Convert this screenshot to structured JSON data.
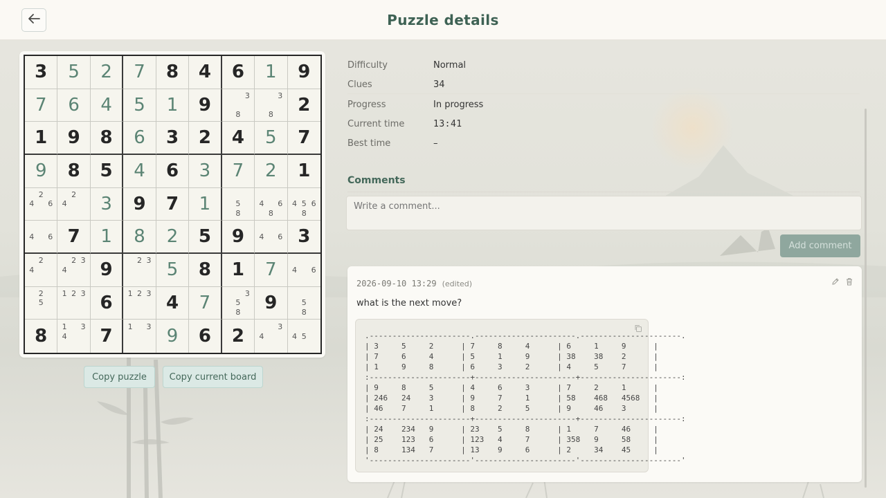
{
  "header": {
    "title": "Puzzle details",
    "back_icon": "arrow-left-icon"
  },
  "board": {
    "given_color": "#262626",
    "user_color": "#5b8474",
    "cells": [
      [
        {
          "v": "3",
          "g": true
        },
        {
          "v": "5",
          "g": false
        },
        {
          "v": "2",
          "g": false
        },
        {
          "v": "7",
          "g": false
        },
        {
          "v": "8",
          "g": true
        },
        {
          "v": "4",
          "g": true
        },
        {
          "v": "6",
          "g": true
        },
        {
          "v": "1",
          "g": false
        },
        {
          "v": "9",
          "g": true
        }
      ],
      [
        {
          "v": "7",
          "g": false
        },
        {
          "v": "6",
          "g": false
        },
        {
          "v": "4",
          "g": false
        },
        {
          "v": "5",
          "g": false
        },
        {
          "v": "1",
          "g": false
        },
        {
          "v": "9",
          "g": true
        },
        {
          "n": "38"
        },
        {
          "n": "38"
        },
        {
          "v": "2",
          "g": true
        }
      ],
      [
        {
          "v": "1",
          "g": true
        },
        {
          "v": "9",
          "g": true
        },
        {
          "v": "8",
          "g": true
        },
        {
          "v": "6",
          "g": false
        },
        {
          "v": "3",
          "g": true
        },
        {
          "v": "2",
          "g": true
        },
        {
          "v": "4",
          "g": true
        },
        {
          "v": "5",
          "g": false
        },
        {
          "v": "7",
          "g": true
        }
      ],
      [
        {
          "v": "9",
          "g": false
        },
        {
          "v": "8",
          "g": true
        },
        {
          "v": "5",
          "g": true
        },
        {
          "v": "4",
          "g": false
        },
        {
          "v": "6",
          "g": true
        },
        {
          "v": "3",
          "g": false
        },
        {
          "v": "7",
          "g": false
        },
        {
          "v": "2",
          "g": false
        },
        {
          "v": "1",
          "g": true
        }
      ],
      [
        {
          "n": "246"
        },
        {
          "n": "24"
        },
        {
          "v": "3",
          "g": false
        },
        {
          "v": "9",
          "g": true
        },
        {
          "v": "7",
          "g": true
        },
        {
          "v": "1",
          "g": false
        },
        {
          "n": "58"
        },
        {
          "n": "468"
        },
        {
          "n": "4568"
        }
      ],
      [
        {
          "n": "46"
        },
        {
          "v": "7",
          "g": true
        },
        {
          "v": "1",
          "g": false
        },
        {
          "v": "8",
          "g": false
        },
        {
          "v": "2",
          "g": false
        },
        {
          "v": "5",
          "g": true
        },
        {
          "v": "9",
          "g": true
        },
        {
          "n": "46"
        },
        {
          "v": "3",
          "g": true
        }
      ],
      [
        {
          "n": "24"
        },
        {
          "n": "234"
        },
        {
          "v": "9",
          "g": true
        },
        {
          "n": "23"
        },
        {
          "v": "5",
          "g": false
        },
        {
          "v": "8",
          "g": true
        },
        {
          "v": "1",
          "g": true
        },
        {
          "v": "7",
          "g": false
        },
        {
          "n": "46"
        }
      ],
      [
        {
          "n": "25"
        },
        {
          "n": "123"
        },
        {
          "v": "6",
          "g": true
        },
        {
          "n": "123"
        },
        {
          "v": "4",
          "g": true
        },
        {
          "v": "7",
          "g": false
        },
        {
          "n": "358"
        },
        {
          "v": "9",
          "g": true
        },
        {
          "n": "58"
        }
      ],
      [
        {
          "v": "8",
          "g": true
        },
        {
          "n": "134"
        },
        {
          "v": "7",
          "g": true
        },
        {
          "n": "13"
        },
        {
          "v": "9",
          "g": false
        },
        {
          "v": "6",
          "g": true
        },
        {
          "v": "2",
          "g": true
        },
        {
          "n": "34"
        },
        {
          "n": "45"
        }
      ]
    ]
  },
  "buttons": {
    "copy_puzzle": "Copy puzzle",
    "copy_current_board": "Copy current board"
  },
  "details": {
    "difficulty": {
      "label": "Difficulty",
      "value": "Normal"
    },
    "clues": {
      "label": "Clues",
      "value": "34"
    },
    "progress": {
      "label": "Progress",
      "value": "In progress"
    },
    "current_time": {
      "label": "Current time",
      "value": "13:41"
    },
    "best_time": {
      "label": "Best time",
      "value": "–"
    }
  },
  "comments": {
    "heading": "Comments",
    "input_placeholder": "Write a comment...",
    "add_button": "Add comment",
    "items": [
      {
        "timestamp": "2026-09-10 13:29",
        "edited": "(edited)",
        "text": "what is the next move?",
        "code": ".----------------------.----------------------.----------------------.\n| 3     5     2      | 7     8     4      | 6     1     9      |\n| 7     6     4      | 5     1     9      | 38    38    2      |\n| 1     9     8      | 6     3     2      | 4     5     7      |\n:----------------------+----------------------+----------------------:\n| 9     8     5      | 4     6     3      | 7     2     1      |\n| 246   24    3      | 9     7     1      | 58    468   4568   |\n| 46    7     1      | 8     2     5      | 9     46    3      |\n:----------------------+----------------------+----------------------:\n| 24    234   9      | 23    5     8      | 1     7     46     |\n| 25    123   6      | 123   4     7      | 358   9     58     |\n| 8     134   7      | 13    9     6      | 2     34    45     |\n'----------------------'----------------------'----------------------'"
      }
    ]
  },
  "icons": {
    "edit": "pencil-icon",
    "delete": "trash-icon",
    "copy": "copy-icon"
  }
}
